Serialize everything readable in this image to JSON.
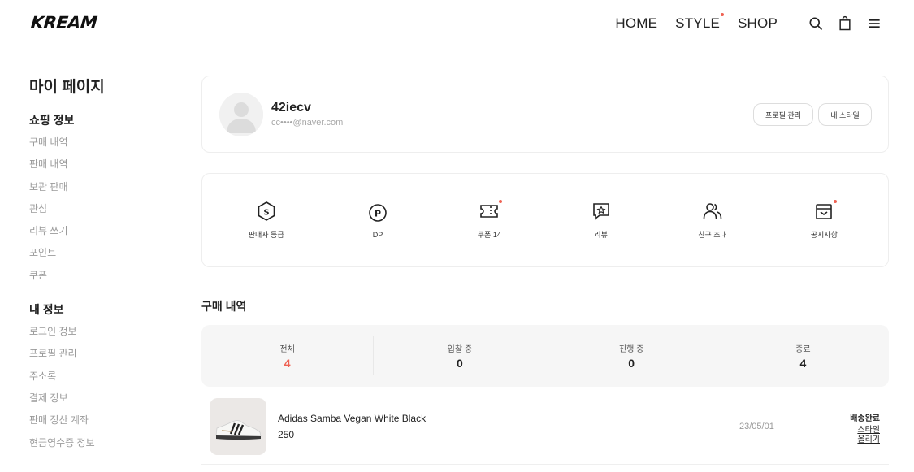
{
  "header": {
    "logo": "KREAM",
    "nav": [
      {
        "label": "HOME",
        "has_dot": false
      },
      {
        "label": "STYLE",
        "has_dot": true
      },
      {
        "label": "SHOP",
        "has_dot": false
      }
    ],
    "icons": [
      "search-icon",
      "shopping-bag-icon",
      "menu-icon"
    ]
  },
  "sidebar": {
    "title": "마이 페이지",
    "shopping": {
      "title": "쇼핑 정보",
      "items": [
        "구매 내역",
        "판매 내역",
        "보관 판매",
        "관심",
        "리뷰 쓰기",
        "포인트",
        "쿠폰"
      ]
    },
    "my_info": {
      "title": "내 정보",
      "items": [
        "로그인 정보",
        "프로필 관리",
        "주소록",
        "결제 정보",
        "판매 정산 계좌",
        "현금영수증 정보"
      ]
    }
  },
  "profile": {
    "username": "42iecv",
    "email": "cc••••@naver.com",
    "manage_button": "프로필 관리",
    "style_button": "내 스타일"
  },
  "shortcuts": [
    {
      "label": "판매자 등급",
      "icon": "seller-grade-icon",
      "has_dot": false
    },
    {
      "label": "DP",
      "icon": "points-icon",
      "has_dot": false
    },
    {
      "label": "쿠폰 14",
      "icon": "coupon-icon",
      "has_dot": true
    },
    {
      "label": "리뷰",
      "icon": "review-icon",
      "has_dot": false
    },
    {
      "label": "친구 초대",
      "icon": "invite-friends-icon",
      "has_dot": false
    },
    {
      "label": "공지사항",
      "icon": "notice-icon",
      "has_dot": true
    }
  ],
  "purchase": {
    "title": "구매 내역",
    "statuses": [
      {
        "label": "전체",
        "value": "4",
        "accent_color": "#ef6253"
      },
      {
        "label": "입찰 중",
        "value": "0"
      },
      {
        "label": "진행 중",
        "value": "0"
      },
      {
        "label": "종료",
        "value": "4"
      }
    ],
    "items": [
      {
        "name": "Adidas Samba Vegan White Black",
        "size": "250",
        "date": "23/05/01",
        "status": "배송완료",
        "link1": "스타일",
        "link2": "올리기"
      }
    ]
  }
}
